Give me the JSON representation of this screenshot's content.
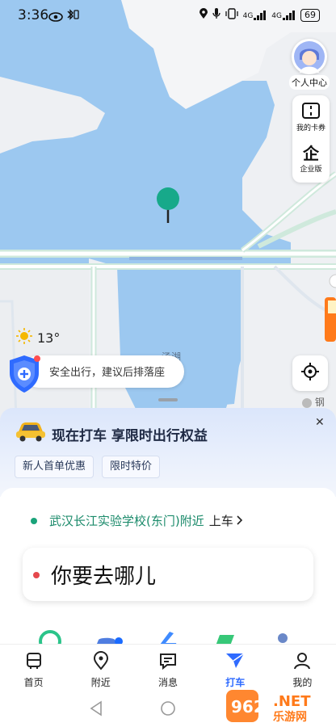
{
  "status_bar": {
    "time": "3:36",
    "battery": "69",
    "signal1": "4G",
    "signal2": "4G"
  },
  "map": {
    "user_center_label": "个人中心",
    "card_coupon_label": "我的卡券",
    "enterprise_label": "企业版",
    "enterprise_glyph": "企",
    "temperature": "13°",
    "lake_label": "汤湖",
    "safety_tip": "安全出行，建议后排落座",
    "steel_label": "钢"
  },
  "promo": {
    "title": "现在打车 享限时出行权益",
    "tags": [
      "新人首单优惠",
      "限时特价"
    ]
  },
  "trip": {
    "start_location": "武汉长江实验学校(东门)附近",
    "start_suffix": "上车",
    "destination_placeholder": "你要去哪儿"
  },
  "bottom_nav": [
    {
      "label": "首页",
      "icon": "bus-icon",
      "active": false
    },
    {
      "label": "附近",
      "icon": "location-pin-icon",
      "active": false
    },
    {
      "label": "消息",
      "icon": "message-icon",
      "active": false
    },
    {
      "label": "打车",
      "icon": "taxi-arrow-icon",
      "active": true
    },
    {
      "label": "我的",
      "icon": "user-icon",
      "active": false
    }
  ],
  "watermark": {
    "text1": "962",
    "text2": ".NET",
    "text3": "乐游网"
  },
  "colors": {
    "accent": "#2f6bff",
    "water": "#9cc8f0",
    "start_green": "#1a8a6a",
    "dest_red": "#e5484d"
  }
}
